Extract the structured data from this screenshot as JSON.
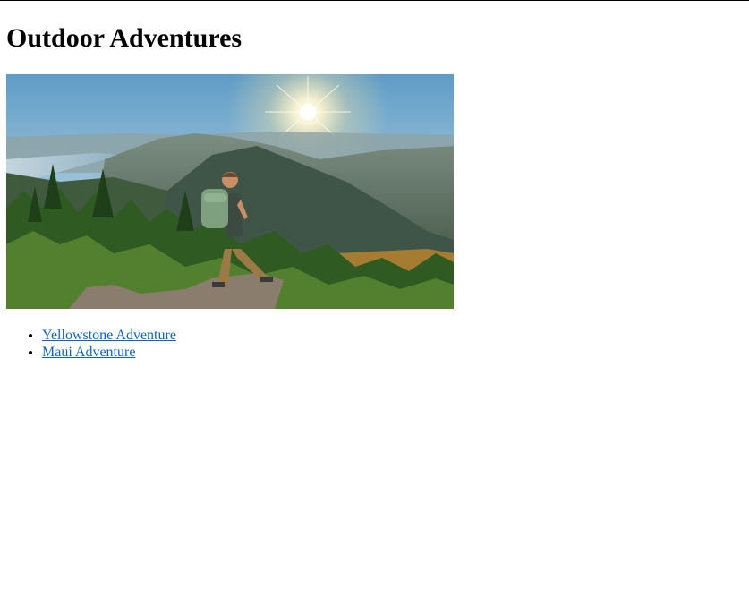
{
  "page": {
    "title": "Outdoor Adventures"
  },
  "hero_image": {
    "description_icon": "mountain-hiker-photo"
  },
  "links": [
    {
      "label": "Yellowstone Adventure"
    },
    {
      "label": "Maui Adventure"
    }
  ],
  "colors": {
    "link": "#0b64c0",
    "sky_top": "#6aa3c9",
    "sky_glow": "#fff6d8",
    "mountain": "#4f6652",
    "forest": "#3f6a2a"
  }
}
